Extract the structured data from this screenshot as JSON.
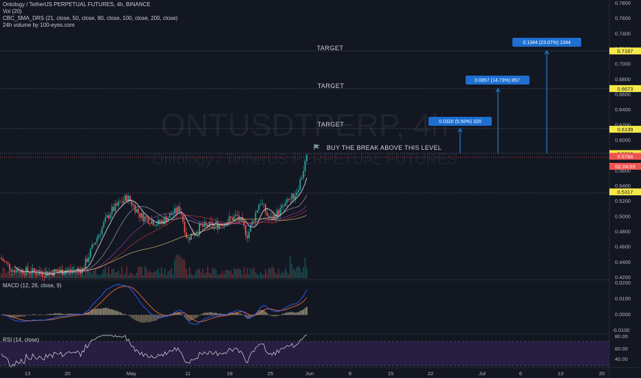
{
  "header": {
    "title": "Ontology / TetherUS PERPETUAL FUTURES, 4h, BINANCE",
    "vol": "Vol (20)",
    "sma": "CBC_SMA_DRS (21, close, 50, close, 80, close, 100, close, 200, close)",
    "volume100": "24h volume by 100-eyes.com"
  },
  "watermark": {
    "symbol": "ONTUSDTPERP, 4h",
    "name": "Ontology / TetherUS PERPETUAL FUTURES"
  },
  "annotations": {
    "buy_text": "BUY THE BREAK ABOVE THIS LEVEL",
    "targets": [
      {
        "label": "TARGET",
        "price": 0.6139,
        "box": "0.0320 (5.50%) 320"
      },
      {
        "label": "TARGET",
        "price": 0.6673,
        "box": "0.0857 (14.73%) 857"
      },
      {
        "label": "TARGET",
        "price": 0.7167,
        "box": "0.1344 (23.07%) 1344"
      }
    ],
    "entry": 0.582,
    "support": 0.5317
  },
  "price_axis": {
    "ticks": [
      "0.7800",
      "0.7600",
      "0.7400",
      "0.7200",
      "0.7000",
      "0.6800",
      "0.6600",
      "0.6400",
      "0.6200",
      "0.6000",
      "0.5800",
      "0.5600",
      "0.5400",
      "0.5200",
      "0.5000",
      "0.4800",
      "0.4600",
      "0.4400",
      "0.4200"
    ],
    "badges": [
      {
        "text": "0.7167",
        "price": 0.7167,
        "color": "#f5e94a",
        "fg": "#131722"
      },
      {
        "text": "0.6673",
        "price": 0.6673,
        "color": "#f5e94a",
        "fg": "#131722"
      },
      {
        "text": "0.6139",
        "price": 0.6139,
        "color": "#f5e94a",
        "fg": "#131722"
      },
      {
        "text": "0.5820",
        "price": 0.582,
        "color": "#f5e94a",
        "fg": "#131722"
      },
      {
        "text": "0.5784",
        "price": 0.5784,
        "color": "#ef5350",
        "fg": "#ffffff"
      },
      {
        "text": "0.5317",
        "price": 0.5317,
        "color": "#f5e94a",
        "fg": "#131722"
      }
    ],
    "countdown": "02:24:03"
  },
  "macd": {
    "title": "MACD (12, 26, close, 9)",
    "ticks": [
      "0.0200",
      "0.0100",
      "0.0000",
      "-0.0100"
    ]
  },
  "rsi": {
    "title": "RSI (14, close)",
    "ticks": [
      "80.00",
      "60.00",
      "40.00"
    ]
  },
  "time_axis": [
    "13",
    "20",
    "May",
    "11",
    "18",
    "25",
    "Jun",
    "8",
    "15",
    "22",
    "Jul",
    "6",
    "13",
    "20"
  ],
  "colors": {
    "bg": "#131722",
    "up": "#26a69a",
    "down": "#ef5350",
    "accent": "#2196f3",
    "grid": "#1e222d"
  },
  "chart_data": {
    "type": "candlestick",
    "ylim": [
      0.41,
      0.79
    ],
    "last_price": 0.5784,
    "series_note": "approximate trend reconstruction"
  }
}
